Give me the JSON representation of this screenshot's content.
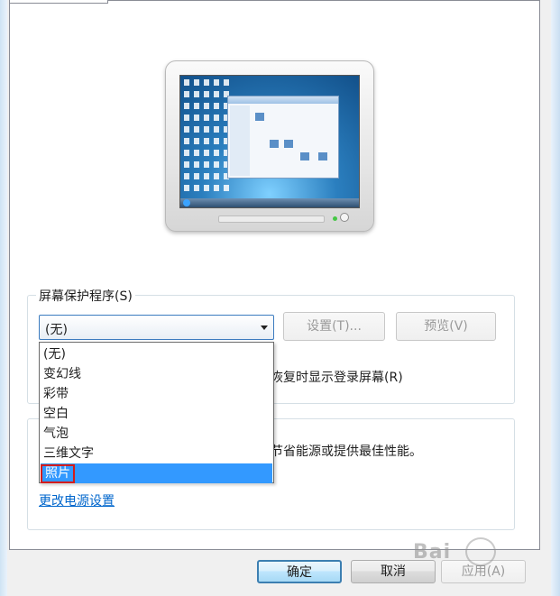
{
  "screensaver": {
    "group_label": "屏幕保护程序(S)",
    "selected_value": "(无)",
    "settings_label": "设置(T)...",
    "preview_label": "预览(V)",
    "resume_text": "恢复时显示登录屏幕(R)",
    "options": [
      "(无)",
      "变幻线",
      "彩带",
      "空白",
      "气泡",
      "三维文字",
      "照片"
    ],
    "highlighted_option": "照片"
  },
  "power": {
    "description": "节省能源或提供最佳性能。",
    "change_link": "更改电源设置"
  },
  "dialog_buttons": {
    "ok": "确定",
    "cancel": "取消",
    "apply": "应用(A)"
  },
  "watermark": {
    "text": "Bai"
  },
  "colors": {
    "selection": "#3399ff",
    "highlight_border": "#d41c1c",
    "link": "#0066cc"
  }
}
